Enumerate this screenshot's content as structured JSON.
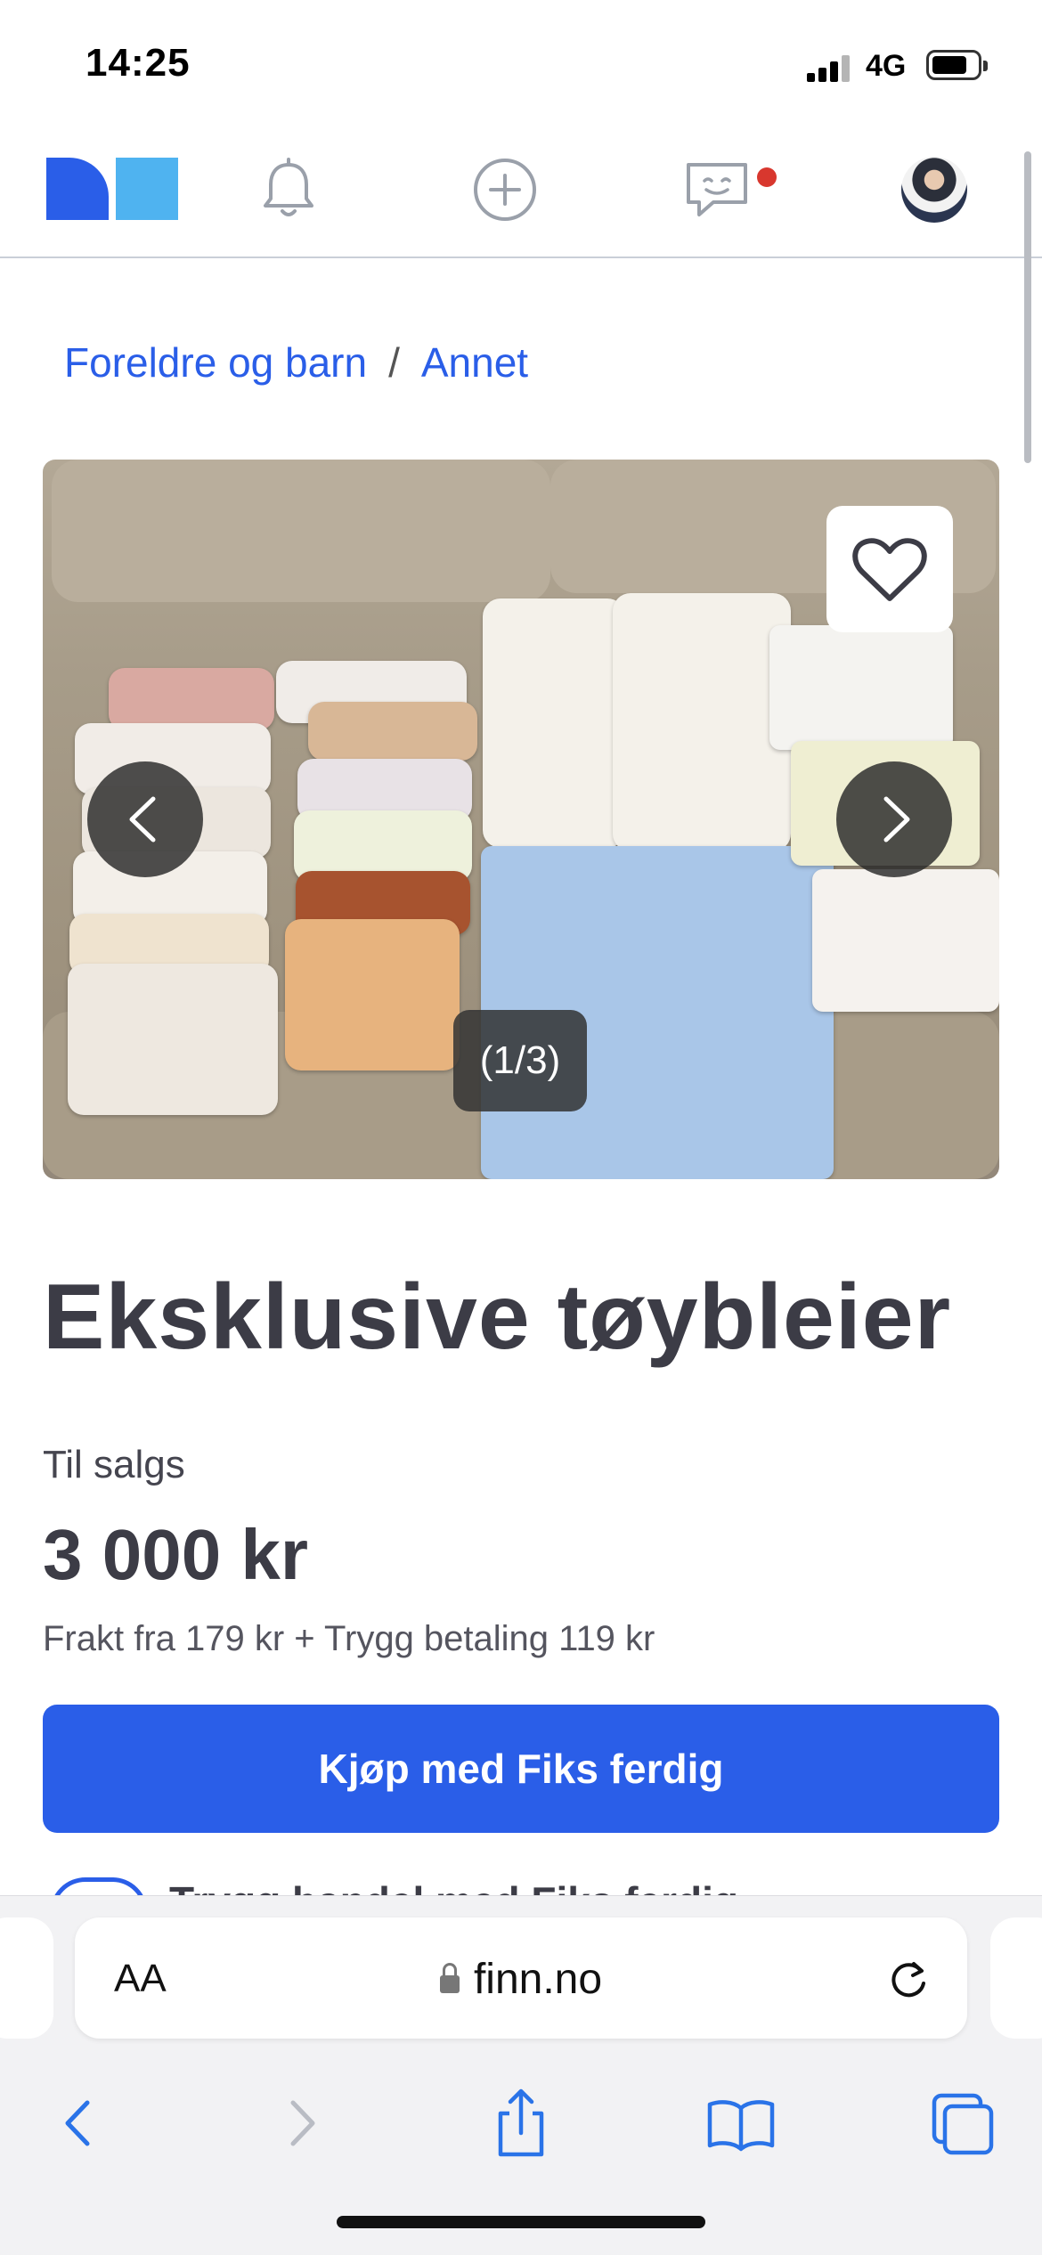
{
  "status": {
    "time": "14:25",
    "network": "4G"
  },
  "nav": {
    "icons": [
      "finn-logo",
      "bell-icon",
      "add-circle-icon",
      "messages-icon",
      "avatar"
    ],
    "has_unread_messages": true
  },
  "breadcrumb": {
    "items": [
      "Foreldre og barn",
      "Annet"
    ],
    "separator": "/"
  },
  "gallery": {
    "counter": "(1/3)"
  },
  "listing": {
    "title": "Eksklusive tøybleier",
    "sale_label": "Til salgs",
    "price": "3 000 kr",
    "shipping": "Frakt fra 179 kr + Trygg betaling 119 kr",
    "buy_label": "Kjøp med Fiks ferdig",
    "peek_text": "Trygg handel med Fiks ferdig"
  },
  "browser": {
    "text_size_label": "AA",
    "url": "finn.no"
  },
  "colors": {
    "accent": "#2a5ee8",
    "logo_light": "#4fb3f0",
    "notification": "#d8372e"
  }
}
